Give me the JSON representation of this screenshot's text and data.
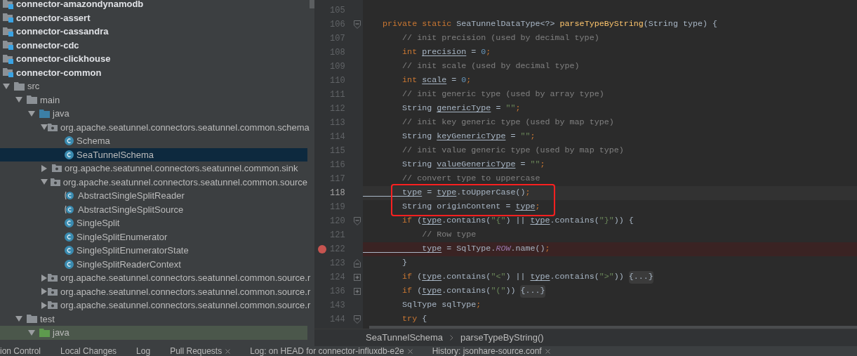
{
  "project_tree": {
    "items": [
      {
        "label": "connector-amazondynamodb",
        "kind": "module"
      },
      {
        "label": "connector-assert",
        "kind": "module"
      },
      {
        "label": "connector-cassandra",
        "kind": "module"
      },
      {
        "label": "connector-cdc",
        "kind": "module"
      },
      {
        "label": "connector-clickhouse",
        "kind": "module"
      },
      {
        "label": "connector-common",
        "kind": "module"
      },
      {
        "label": "src",
        "kind": "folder",
        "expanded": true,
        "selected": false,
        "children": [
          {
            "label": "main",
            "kind": "folder",
            "expanded": true,
            "selected": false,
            "children": [
              {
                "label": "java",
                "kind": "source-folder",
                "expanded": true,
                "selected": false,
                "children": [
                  {
                    "label": "org.apache.seatunnel.connectors.seatunnel.common.schema",
                    "kind": "package",
                    "expanded": true,
                    "selected": false,
                    "children": [
                      {
                        "label": "Schema",
                        "kind": "class",
                        "selected": false
                      },
                      {
                        "label": "SeaTunnelSchema",
                        "kind": "class",
                        "selected": true
                      }
                    ]
                  },
                  {
                    "label": "org.apache.seatunnel.connectors.seatunnel.common.sink",
                    "kind": "package",
                    "expanded": false,
                    "selected": false
                  },
                  {
                    "label": "org.apache.seatunnel.connectors.seatunnel.common.source",
                    "kind": "package",
                    "expanded": true,
                    "selected": false,
                    "children": [
                      {
                        "label": "AbstractSingleSplitReader",
                        "kind": "abstract-class",
                        "selected": false
                      },
                      {
                        "label": "AbstractSingleSplitSource",
                        "kind": "abstract-class",
                        "selected": false
                      },
                      {
                        "label": "SingleSplit",
                        "kind": "class",
                        "selected": false
                      },
                      {
                        "label": "SingleSplitEnumerator",
                        "kind": "class",
                        "selected": false
                      },
                      {
                        "label": "SingleSplitEnumeratorState",
                        "kind": "class",
                        "selected": false
                      },
                      {
                        "label": "SingleSplitReaderContext",
                        "kind": "class",
                        "selected": false
                      }
                    ]
                  },
                  {
                    "label": "org.apache.seatunnel.connectors.seatunnel.common.source.r",
                    "kind": "package",
                    "expanded": false,
                    "selected": false
                  },
                  {
                    "label": "org.apache.seatunnel.connectors.seatunnel.common.source.r",
                    "kind": "package",
                    "expanded": false,
                    "selected": false
                  },
                  {
                    "label": "org.apache.seatunnel.connectors.seatunnel.common.source.r",
                    "kind": "package",
                    "expanded": false,
                    "selected": false
                  }
                ]
              }
            ]
          },
          {
            "label": "test",
            "kind": "folder",
            "expanded": true,
            "selected": false,
            "children": [
              {
                "label": "java",
                "kind": "test-folder",
                "expanded": true,
                "selected": false
              }
            ]
          }
        ]
      }
    ]
  },
  "editor": {
    "lines": [
      {
        "number": "105",
        "current": false
      },
      {
        "number": "106",
        "fold": {
          "kind": "start"
        },
        "current": false,
        "tokens": [
          {
            "kind": "kw",
            "text": "    private static "
          },
          {
            "kind": "plain",
            "text": "SeaTunnelDataType<?> "
          },
          {
            "kind": "fn",
            "text": "parseTypeByString"
          },
          {
            "kind": "plain",
            "text": "(String type) {"
          }
        ]
      },
      {
        "number": "107",
        "current": false,
        "tokens": [
          {
            "kind": "com",
            "text": "        // init precision (used by decimal type)"
          }
        ]
      },
      {
        "number": "108",
        "current": false,
        "tokens": [
          {
            "kind": "kw",
            "text": "        int "
          },
          {
            "kind": "var",
            "text": "precision"
          },
          {
            "kind": "plain",
            "text": " = "
          },
          {
            "kind": "num",
            "text": "0"
          },
          {
            "kind": "kw",
            "text": ";"
          }
        ]
      },
      {
        "number": "109",
        "current": false,
        "tokens": [
          {
            "kind": "com",
            "text": "        // init scale (used by decimal type)"
          }
        ]
      },
      {
        "number": "110",
        "current": false,
        "tokens": [
          {
            "kind": "kw",
            "text": "        int "
          },
          {
            "kind": "var",
            "text": "scale"
          },
          {
            "kind": "plain",
            "text": " = "
          },
          {
            "kind": "num",
            "text": "0"
          },
          {
            "kind": "kw",
            "text": ";"
          }
        ]
      },
      {
        "number": "111",
        "current": false,
        "tokens": [
          {
            "kind": "com",
            "text": "        // init generic type (used by array type)"
          }
        ]
      },
      {
        "number": "112",
        "current": false,
        "tokens": [
          {
            "kind": "plain",
            "text": "        String "
          },
          {
            "kind": "var",
            "text": "genericType"
          },
          {
            "kind": "plain",
            "text": " = "
          },
          {
            "kind": "str",
            "text": "\"\""
          },
          {
            "kind": "kw",
            "text": ";"
          }
        ]
      },
      {
        "number": "113",
        "current": false,
        "tokens": [
          {
            "kind": "com",
            "text": "        // init key generic type (used by map type)"
          }
        ]
      },
      {
        "number": "114",
        "current": false,
        "tokens": [
          {
            "kind": "plain",
            "text": "        String "
          },
          {
            "kind": "var",
            "text": "keyGenericType"
          },
          {
            "kind": "plain",
            "text": " = "
          },
          {
            "kind": "str",
            "text": "\"\""
          },
          {
            "kind": "kw",
            "text": ";"
          }
        ]
      },
      {
        "number": "115",
        "current": false,
        "tokens": [
          {
            "kind": "com",
            "text": "        // init value generic type (used by map type)"
          }
        ]
      },
      {
        "number": "116",
        "current": false,
        "tokens": [
          {
            "kind": "plain",
            "text": "        String "
          },
          {
            "kind": "var",
            "text": "valueGenericType"
          },
          {
            "kind": "plain",
            "text": " = "
          },
          {
            "kind": "str",
            "text": "\"\""
          },
          {
            "kind": "kw",
            "text": ";"
          }
        ]
      },
      {
        "number": "117",
        "current": false,
        "tokens": [
          {
            "kind": "com",
            "text": "        // convert type to uppercase"
          }
        ]
      },
      {
        "number": "118",
        "current": true,
        "boxed": true,
        "tokens": [
          {
            "kind": "var",
            "text": "        type"
          },
          {
            "kind": "plain",
            "text": " = "
          },
          {
            "kind": "var",
            "text": "type"
          },
          {
            "kind": "plain",
            "text": ".toUpperCase()"
          },
          {
            "kind": "kw",
            "text": ";"
          }
        ]
      },
      {
        "number": "119",
        "current": false,
        "boxed": true,
        "tokens": [
          {
            "kind": "plain",
            "text": "        String originContent = "
          },
          {
            "kind": "var",
            "text": "type"
          },
          {
            "kind": "kw",
            "text": ";"
          }
        ]
      },
      {
        "number": "120",
        "fold": {
          "kind": "start"
        },
        "current": false,
        "tokens": [
          {
            "kind": "kw",
            "text": "        if "
          },
          {
            "kind": "plain",
            "text": "("
          },
          {
            "kind": "var",
            "text": "type"
          },
          {
            "kind": "plain",
            "text": ".contains("
          },
          {
            "kind": "str",
            "text": "\"{\""
          },
          {
            "kind": "plain",
            "text": ") || "
          },
          {
            "kind": "var",
            "text": "type"
          },
          {
            "kind": "plain",
            "text": ".contains("
          },
          {
            "kind": "str",
            "text": "\"}\""
          },
          {
            "kind": "plain",
            "text": ")) {"
          }
        ]
      },
      {
        "number": "121",
        "current": false,
        "tokens": [
          {
            "kind": "com",
            "text": "            // Row type"
          }
        ]
      },
      {
        "number": "122",
        "breakpoint": true,
        "current": false,
        "tokens": [
          {
            "kind": "var",
            "text": "            type"
          },
          {
            "kind": "plain",
            "text": " = SqlType."
          },
          {
            "kind": "const",
            "text": "ROW"
          },
          {
            "kind": "plain",
            "text": ".name()"
          },
          {
            "kind": "kw",
            "text": ";"
          }
        ]
      },
      {
        "number": "123",
        "fold": {
          "kind": "end"
        },
        "current": false,
        "tokens": [
          {
            "kind": "plain",
            "text": "        }"
          }
        ]
      },
      {
        "number": "124",
        "fold": {
          "kind": "collapsed"
        },
        "current": false,
        "tokens": [
          {
            "kind": "kw",
            "text": "        if "
          },
          {
            "kind": "plain",
            "text": "("
          },
          {
            "kind": "var",
            "text": "type"
          },
          {
            "kind": "plain",
            "text": ".contains("
          },
          {
            "kind": "str",
            "text": "\"<\""
          },
          {
            "kind": "plain",
            "text": ") || "
          },
          {
            "kind": "var",
            "text": "type"
          },
          {
            "kind": "plain",
            "text": ".contains("
          },
          {
            "kind": "str",
            "text": "\">\""
          },
          {
            "kind": "plain",
            "text": ")) "
          },
          {
            "kind": "folded",
            "text": "{...}"
          }
        ]
      },
      {
        "number": "136",
        "fold": {
          "kind": "collapsed"
        },
        "current": false,
        "tokens": [
          {
            "kind": "kw",
            "text": "        if "
          },
          {
            "kind": "plain",
            "text": "("
          },
          {
            "kind": "var",
            "text": "type"
          },
          {
            "kind": "plain",
            "text": ".contains("
          },
          {
            "kind": "str",
            "text": "\"(\""
          },
          {
            "kind": "plain",
            "text": ")) "
          },
          {
            "kind": "folded",
            "text": "{...}"
          }
        ]
      },
      {
        "number": "143",
        "current": false,
        "tokens": [
          {
            "kind": "plain",
            "text": "        SqlType sqlType"
          },
          {
            "kind": "kw",
            "text": ";"
          }
        ]
      },
      {
        "number": "144",
        "fold": {
          "kind": "start"
        },
        "current": false,
        "tokens": [
          {
            "kind": "kw",
            "text": "        try "
          },
          {
            "kind": "plain",
            "text": "{"
          }
        ]
      }
    ],
    "breadcrumbs": [
      "SeaTunnelSchema",
      "parseTypeByString()"
    ]
  },
  "bottom_tabs": [
    {
      "label": "ion Control",
      "closable": false
    },
    {
      "label": "Local Changes",
      "closable": false
    },
    {
      "label": "Log",
      "closable": false
    },
    {
      "label": "Pull Requests",
      "closable": true
    },
    {
      "label": "Log: on HEAD for connector-influxdb-e2e",
      "closable": true
    },
    {
      "label": "History: jsonhare-source.conf",
      "closable": true
    }
  ]
}
